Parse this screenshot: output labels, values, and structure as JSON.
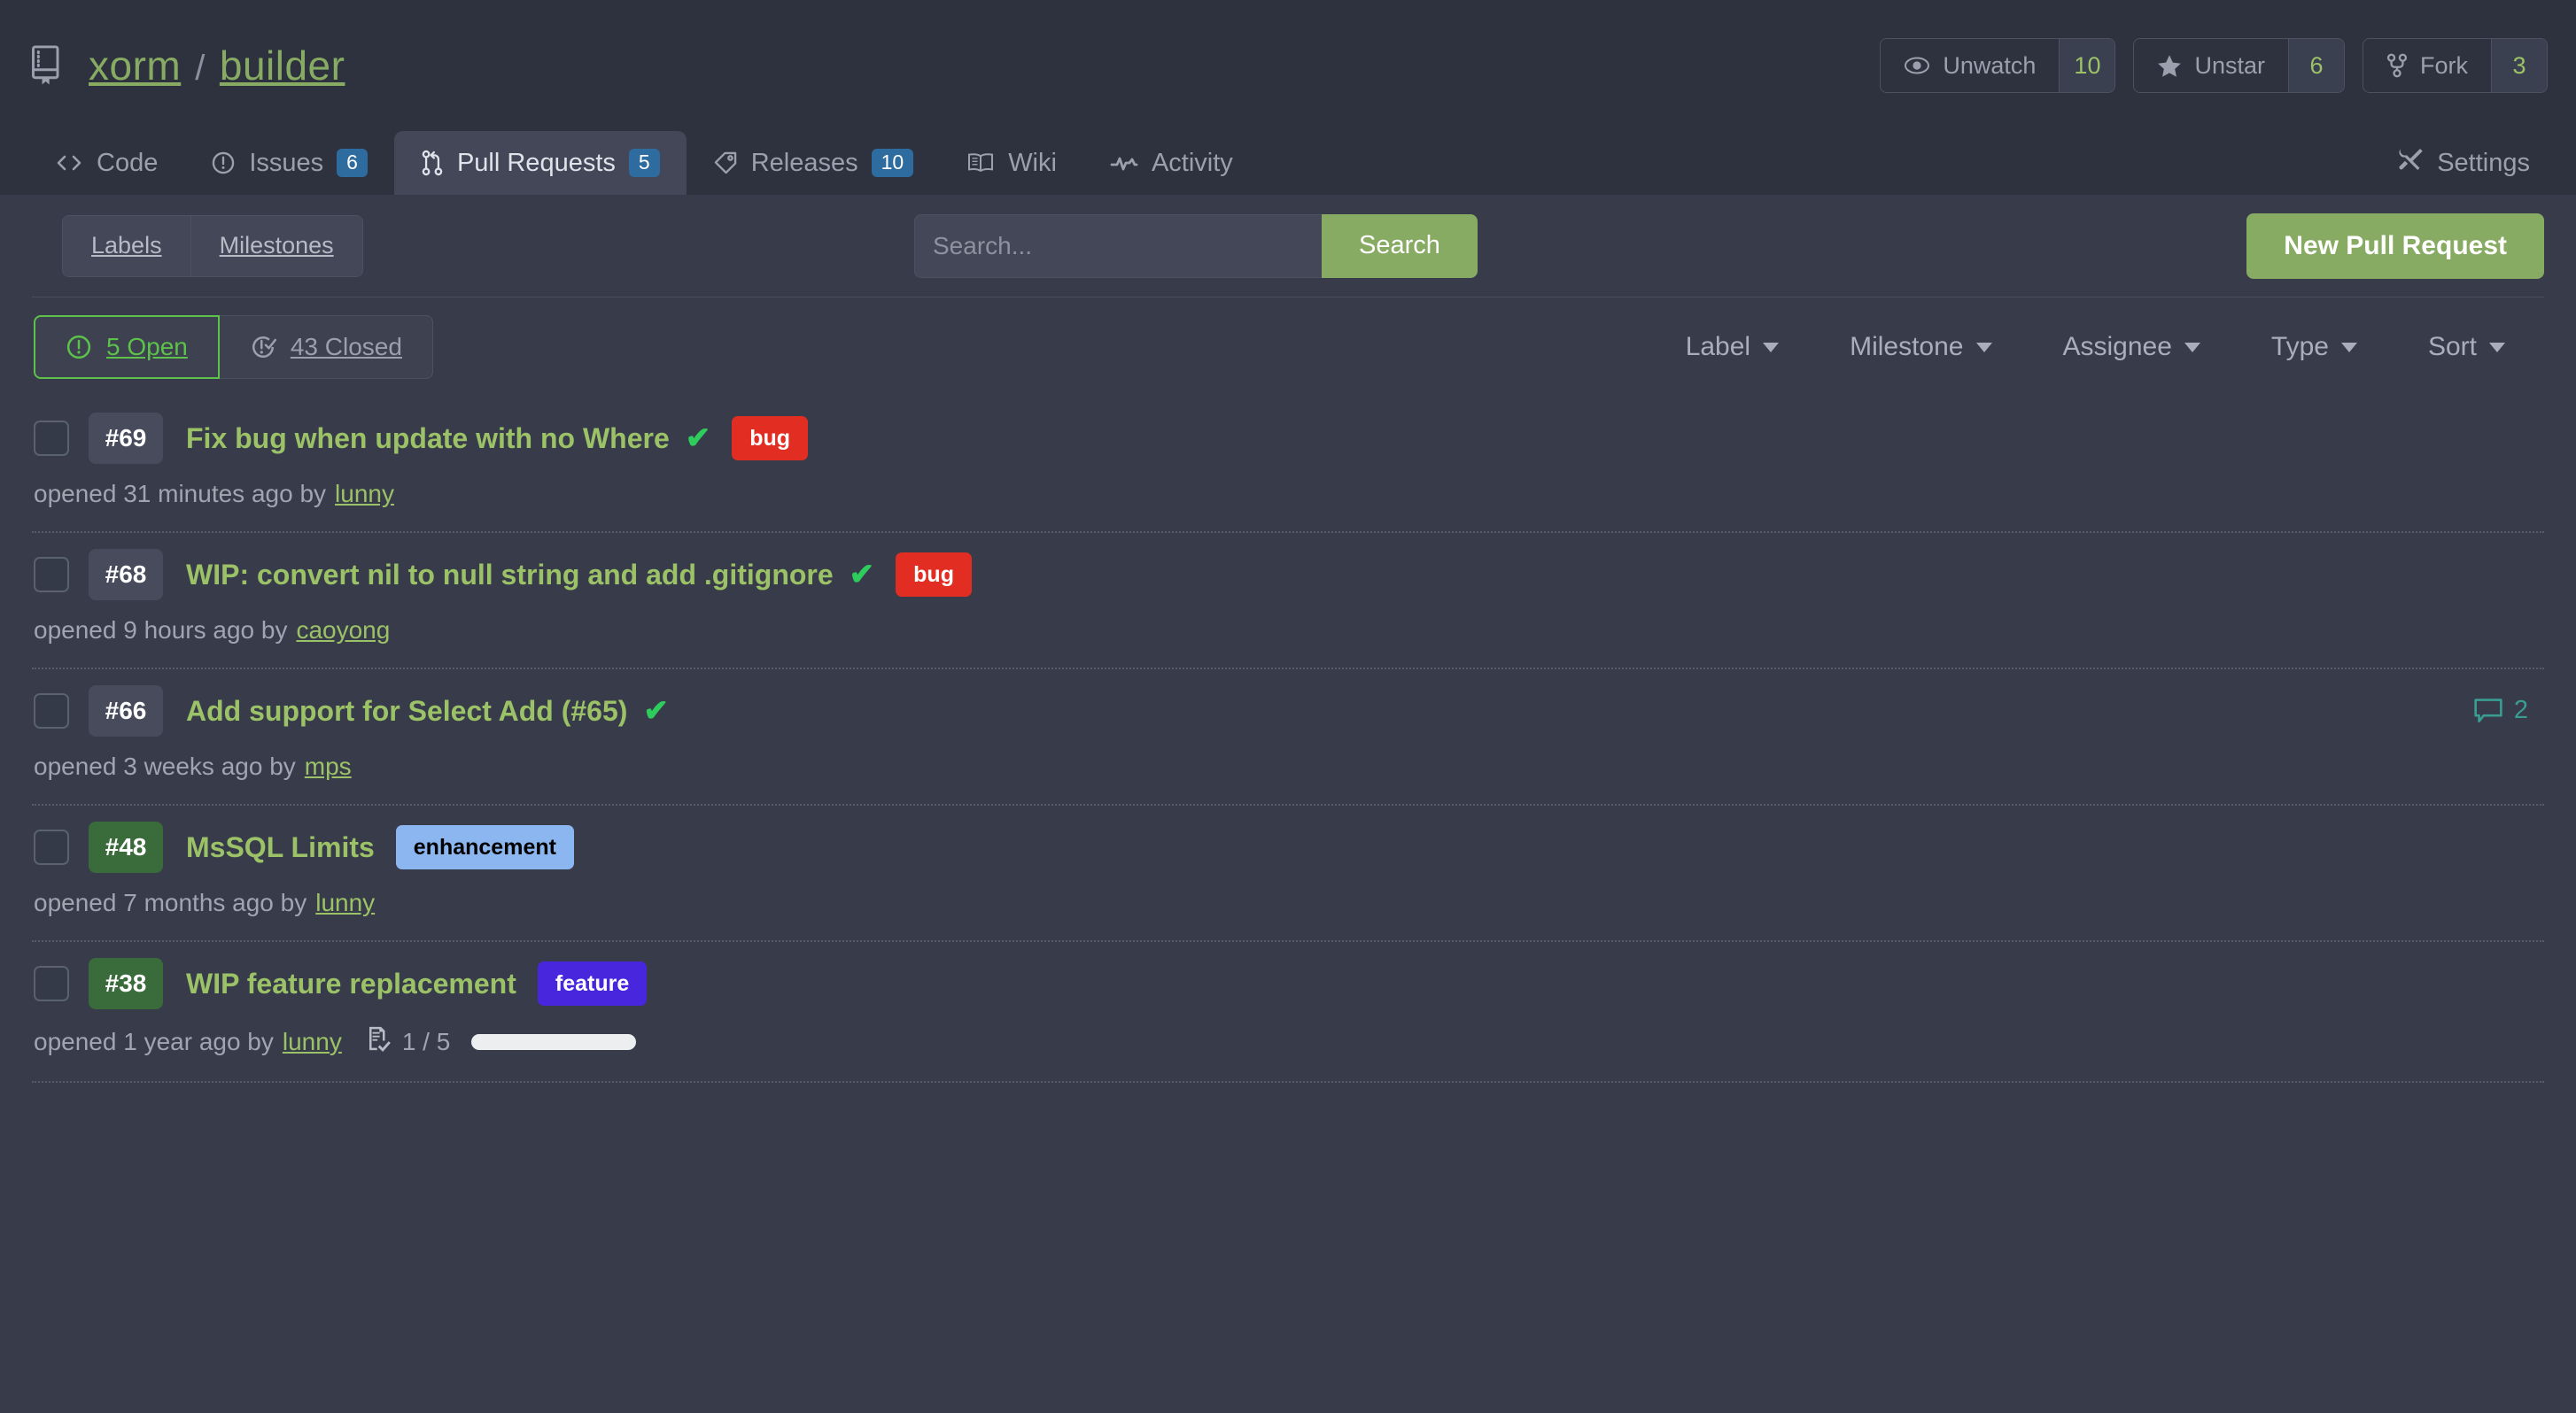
{
  "header": {
    "repo_icon": "repo-book-icon",
    "owner": "xorm",
    "separator": "/",
    "name": "builder",
    "actions": [
      {
        "icon": "eye-icon",
        "label": "Unwatch",
        "count": "10"
      },
      {
        "icon": "star-icon",
        "label": "Unstar",
        "count": "6"
      },
      {
        "icon": "fork-icon",
        "label": "Fork",
        "count": "3"
      }
    ]
  },
  "nav": {
    "items": [
      {
        "icon": "code-icon",
        "label": "Code",
        "badge": ""
      },
      {
        "icon": "issue-opened-icon",
        "label": "Issues",
        "badge": "6"
      },
      {
        "icon": "git-pull-request-icon",
        "label": "Pull Requests",
        "badge": "5",
        "active": true
      },
      {
        "icon": "tag-icon",
        "label": "Releases",
        "badge": "10"
      },
      {
        "icon": "book-icon",
        "label": "Wiki",
        "badge": ""
      },
      {
        "icon": "pulse-icon",
        "label": "Activity",
        "badge": ""
      }
    ],
    "settings": {
      "icon": "tools-icon",
      "label": "Settings"
    }
  },
  "toolbar": {
    "labels_button": "Labels",
    "milestones_button": "Milestones",
    "search_placeholder": "Search...",
    "search_value": "",
    "search_button": "Search",
    "new_pr_button": "New Pull Request"
  },
  "filters": {
    "open_label": "5 Open",
    "closed_label": "43 Closed",
    "open_active": true,
    "dropdowns": [
      "Label",
      "Milestone",
      "Assignee",
      "Type",
      "Sort"
    ]
  },
  "colors": {
    "accent_green": "#87ab63",
    "title_green": "#9cc267",
    "open_green": "#5cc24a",
    "badge_blue": "#2e6ca0",
    "page_bg": "#383c4a",
    "header_bg": "#2e323e",
    "comment_teal": "#3a9d92"
  },
  "pull_requests": [
    {
      "index": "#69",
      "index_style": "normal",
      "title": "Fix bug when update with no Where",
      "check": "✔",
      "labels": [
        {
          "text": "bug",
          "color": "#e22d22"
        }
      ],
      "meta_prefix": "opened 31 minutes ago by",
      "author": "lunny",
      "comments": "",
      "tasks": null
    },
    {
      "index": "#68",
      "index_style": "normal",
      "title": "WIP: convert nil to null string and add .gitignore",
      "check": "✔",
      "labels": [
        {
          "text": "bug",
          "color": "#e22d22"
        }
      ],
      "meta_prefix": "opened 9 hours ago by",
      "author": "caoyong",
      "comments": "",
      "tasks": null
    },
    {
      "index": "#66",
      "index_style": "normal",
      "title": "Add support for Select Add (#65)",
      "check": "✔",
      "labels": [],
      "meta_prefix": "opened 3 weeks ago by",
      "author": "mps",
      "comments": "2",
      "tasks": null
    },
    {
      "index": "#48",
      "index_style": "merged",
      "title": "MsSQL Limits",
      "check": "",
      "labels": [
        {
          "text": "enhancement",
          "color": "#8cb6f0",
          "text_color": "#000000"
        }
      ],
      "meta_prefix": "opened 7 months ago by",
      "author": "lunny",
      "comments": "",
      "tasks": null
    },
    {
      "index": "#38",
      "index_style": "merged",
      "title": "WIP feature replacement",
      "check": "",
      "labels": [
        {
          "text": "feature",
          "color": "#4726dd"
        }
      ],
      "meta_prefix": "opened 1 year ago by",
      "author": "lunny",
      "comments": "",
      "tasks": {
        "icon": "checklist-icon",
        "text": "1 / 5",
        "done": 1,
        "total": 5,
        "percent": 20
      }
    }
  ]
}
